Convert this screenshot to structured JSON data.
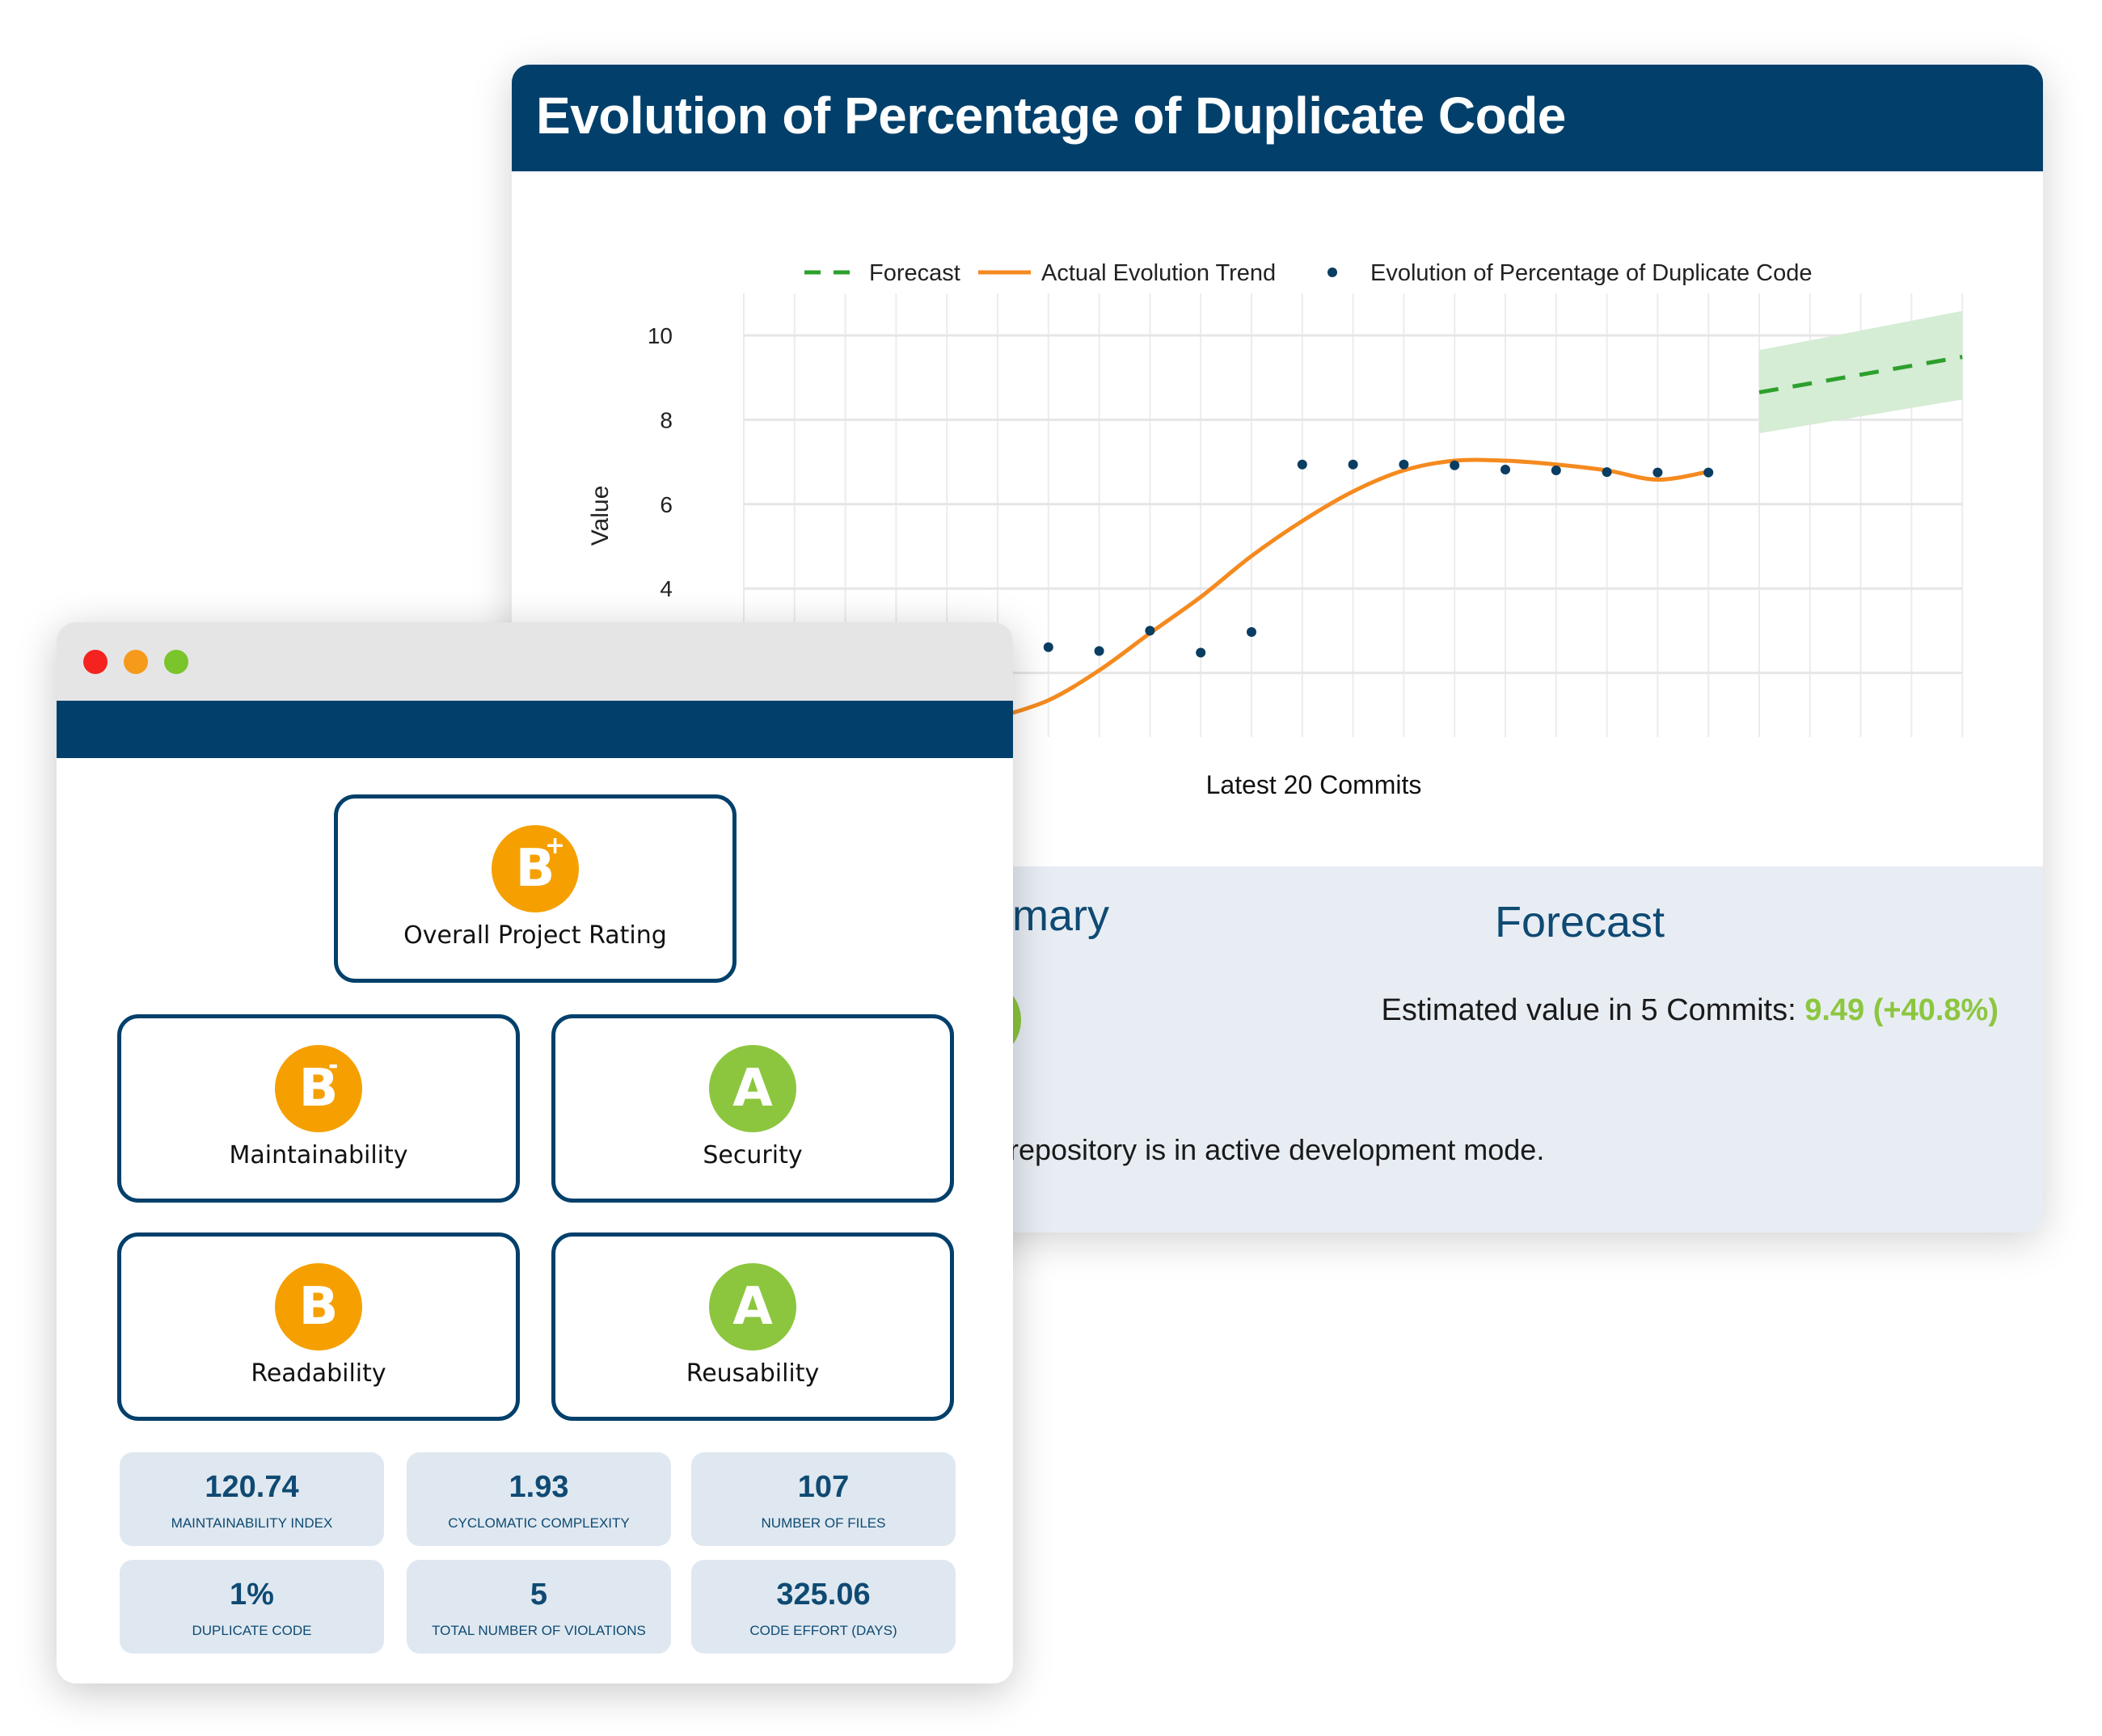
{
  "back_card": {
    "title": "Evolution of Percentage of Duplicate Code",
    "summary_heading": "Summary",
    "forecast_heading": "Forecast",
    "estimate_label": "Estimated value in 5 Commits:",
    "estimate_value": "9.49 (+40.8%)",
    "mode_text": "repository is in active development mode."
  },
  "chart_data": {
    "type": "scatter",
    "xlabel": "Latest 20 Commits",
    "ylabel": "Value",
    "yticks": [
      "4",
      "6",
      "8",
      "10"
    ],
    "ylim": [
      2,
      10.5
    ],
    "grid": true,
    "legend_placement": "top",
    "legend": [
      "Forecast",
      "Actual Evolution Trend",
      "Evolution of Percentage of Duplicate Code"
    ],
    "points": [
      null,
      null,
      null,
      null,
      null,
      null,
      2.61,
      2.52,
      3.0,
      2.48,
      2.97,
      6.94,
      6.94,
      6.94,
      6.92,
      6.82,
      6.8,
      6.76,
      6.75,
      6.75
    ],
    "trend": [
      null,
      null,
      null,
      null,
      null,
      0.95,
      1.35,
      2.06,
      2.94,
      3.8,
      4.77,
      5.6,
      6.3,
      6.8,
      7.03,
      7.03,
      6.94,
      6.8,
      6.58,
      6.77
    ],
    "forecast": {
      "x": [
        21,
        25
      ],
      "y": [
        8.65,
        9.49
      ],
      "upper": [
        9.65,
        10.58
      ],
      "lower": [
        7.68,
        8.48
      ]
    },
    "colors": {
      "points": "#0a3d62",
      "trend": "#f58a1f",
      "forecast": "#2ca02c",
      "band": "#d5ecd5"
    }
  },
  "window": {
    "overall": {
      "grade": "B",
      "modifier": "+",
      "label": "Overall Project Rating",
      "color": "#f5a000"
    },
    "ratings": [
      {
        "grade": "B",
        "modifier": "-",
        "label": "Maintainability",
        "color": "#f5a000"
      },
      {
        "grade": "A",
        "modifier": "",
        "label": "Security",
        "color": "#8cc63f"
      },
      {
        "grade": "B",
        "modifier": "",
        "label": "Readability",
        "color": "#f5a000"
      },
      {
        "grade": "A",
        "modifier": "",
        "label": "Reusability",
        "color": "#8cc63f"
      }
    ],
    "metrics": [
      {
        "value": "120.74",
        "label": "MAINTAINABILITY INDEX"
      },
      {
        "value": "1.93",
        "label": "CYCLOMATIC COMPLEXITY"
      },
      {
        "value": "107",
        "label": "NUMBER OF FILES"
      },
      {
        "value": "1%",
        "label": "DUPLICATE CODE"
      },
      {
        "value": "5",
        "label": "TOTAL NUMBER OF VIOLATIONS"
      },
      {
        "value": "325.06",
        "label": "CODE EFFORT (DAYS)"
      }
    ]
  }
}
